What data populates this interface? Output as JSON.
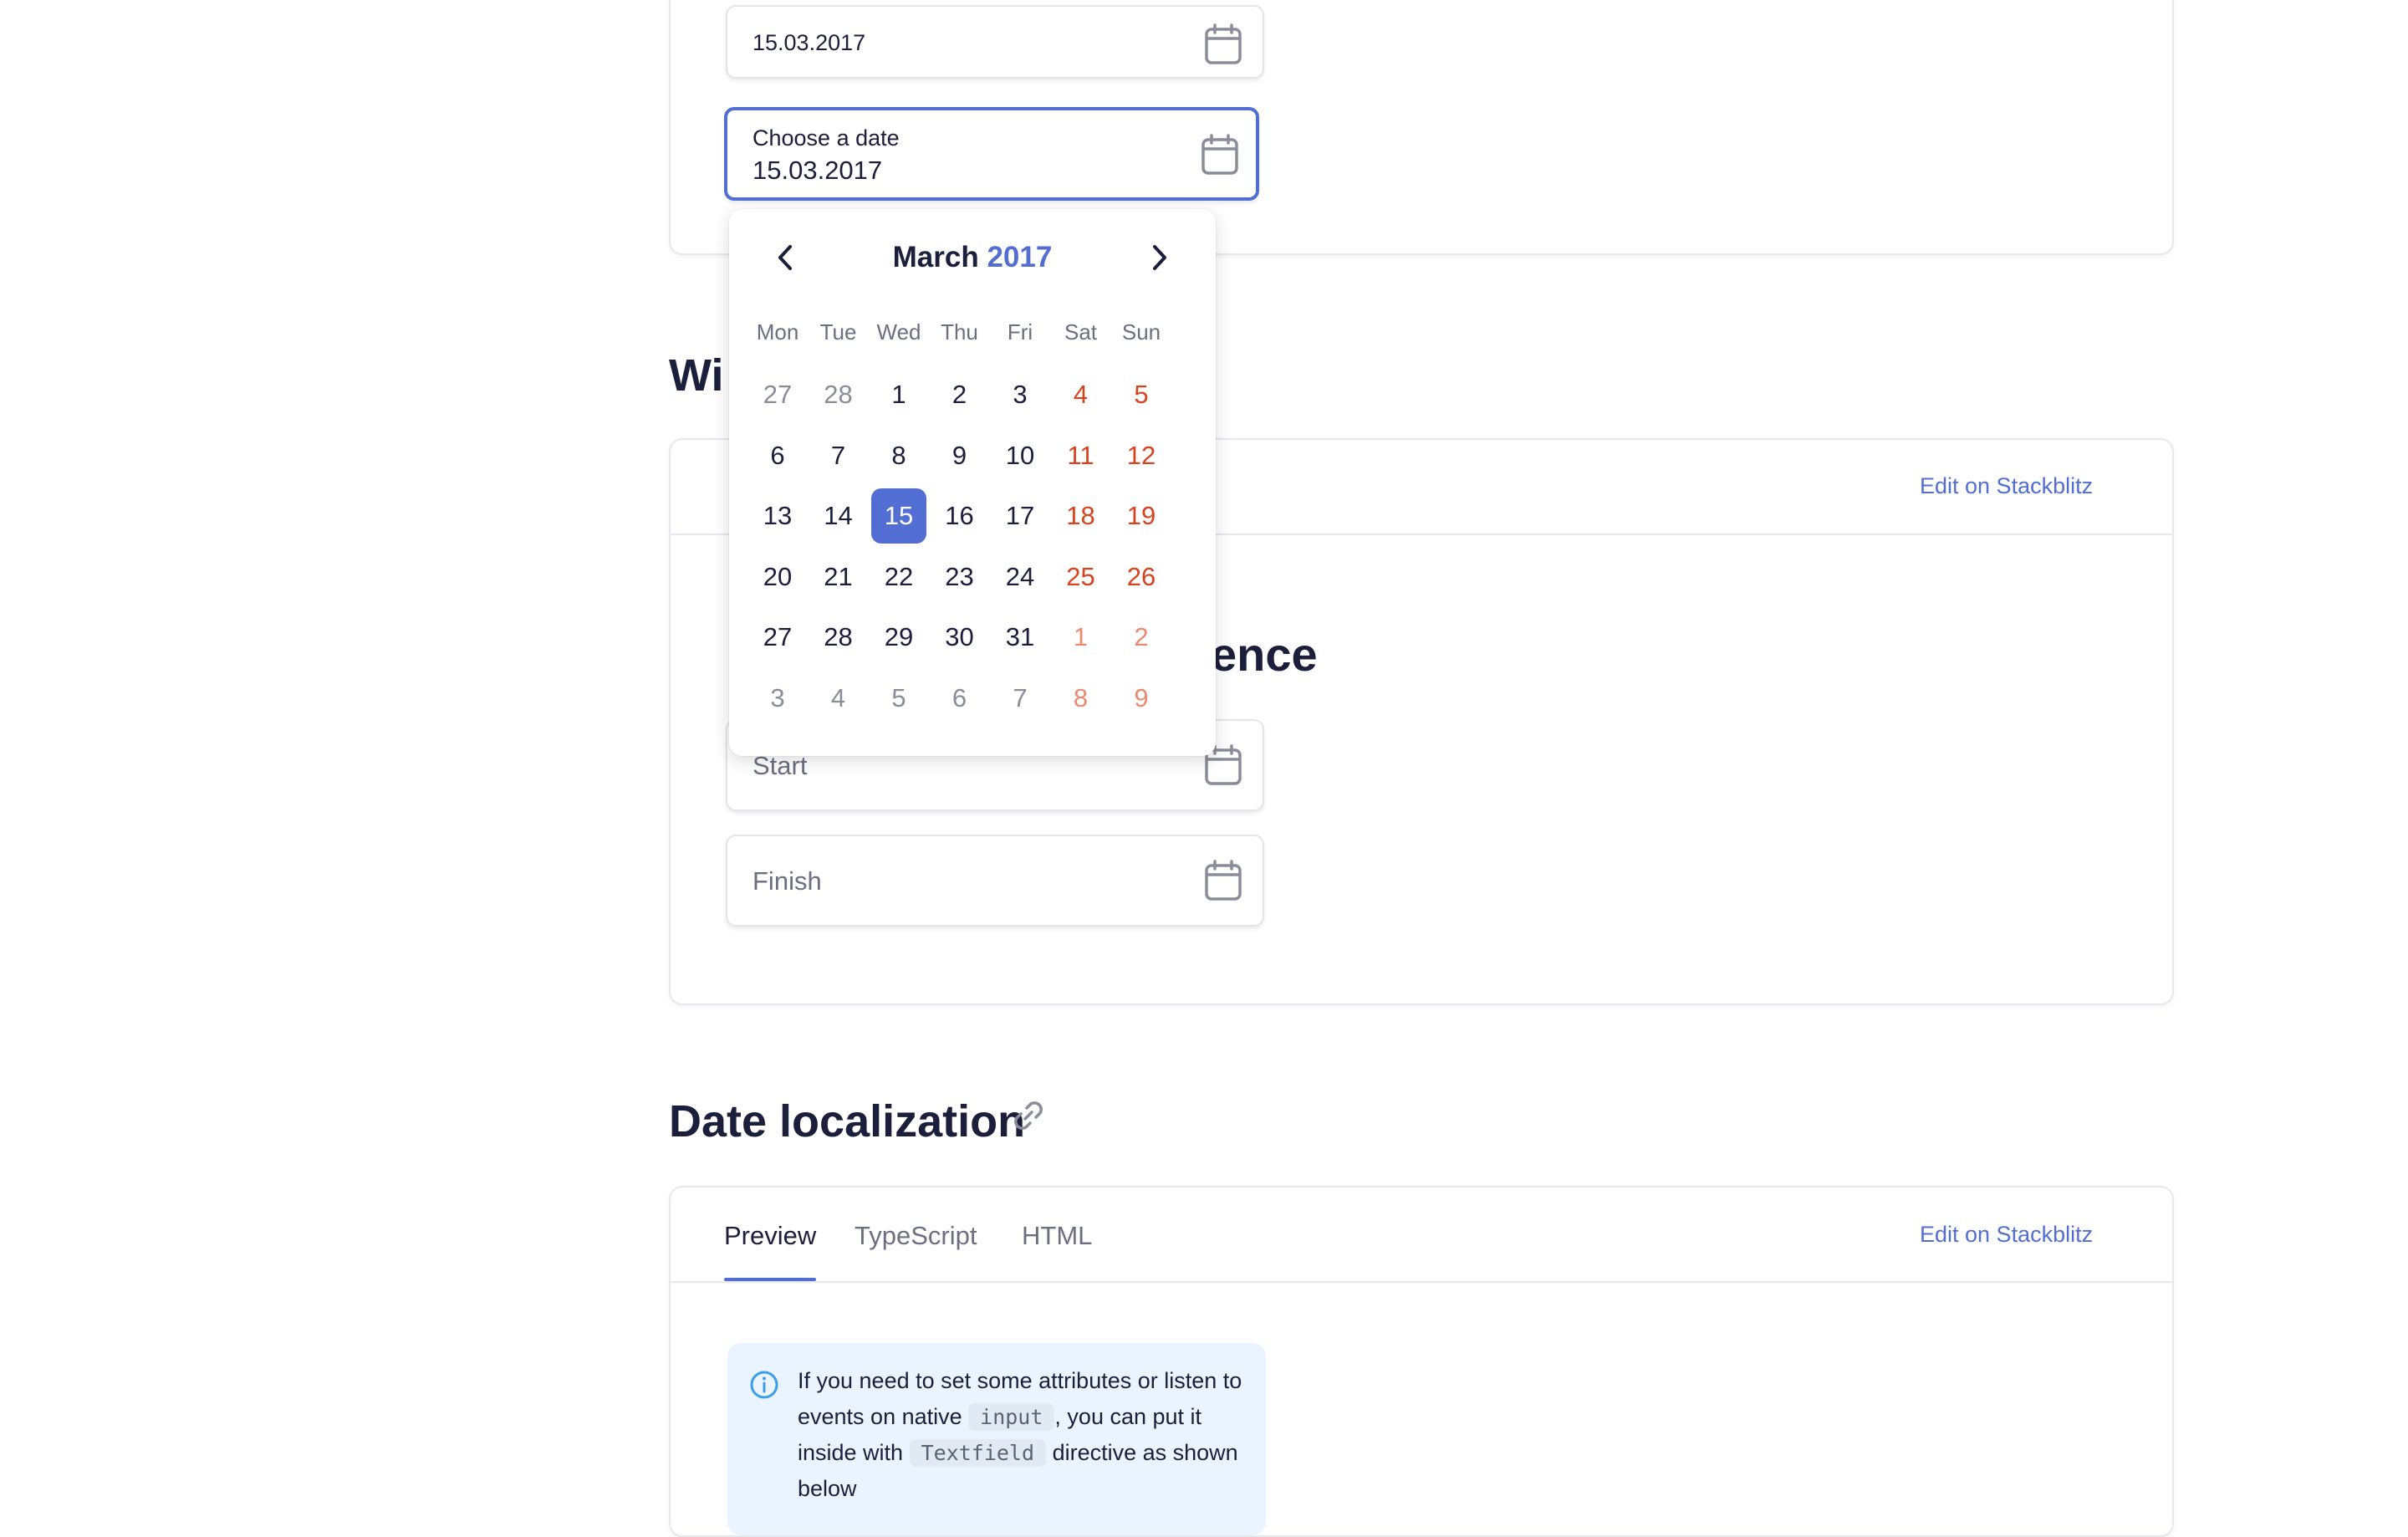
{
  "top_card": {
    "field1_value": "15.03.2017",
    "field2_label": "Choose a date",
    "field2_value": "15.03.2017"
  },
  "calendar": {
    "month": "March",
    "year": "2017",
    "weekdays": [
      "Mon",
      "Tue",
      "Wed",
      "Thu",
      "Fri",
      "Sat",
      "Sun"
    ],
    "weeks": [
      [
        [
          "27",
          "other"
        ],
        [
          "28",
          "other"
        ],
        [
          "1",
          ""
        ],
        [
          "2",
          ""
        ],
        [
          "3",
          ""
        ],
        [
          "4",
          "weekend"
        ],
        [
          "5",
          "weekend"
        ]
      ],
      [
        [
          "6",
          ""
        ],
        [
          "7",
          ""
        ],
        [
          "8",
          ""
        ],
        [
          "9",
          ""
        ],
        [
          "10",
          ""
        ],
        [
          "11",
          "weekend"
        ],
        [
          "12",
          "weekend"
        ]
      ],
      [
        [
          "13",
          ""
        ],
        [
          "14",
          ""
        ],
        [
          "15",
          "selected"
        ],
        [
          "16",
          ""
        ],
        [
          "17",
          ""
        ],
        [
          "18",
          "weekend"
        ],
        [
          "19",
          "weekend"
        ]
      ],
      [
        [
          "20",
          ""
        ],
        [
          "21",
          ""
        ],
        [
          "22",
          ""
        ],
        [
          "23",
          ""
        ],
        [
          "24",
          ""
        ],
        [
          "25",
          "weekend"
        ],
        [
          "26",
          "weekend"
        ]
      ],
      [
        [
          "27",
          ""
        ],
        [
          "28",
          ""
        ],
        [
          "29",
          ""
        ],
        [
          "30",
          ""
        ],
        [
          "31",
          ""
        ],
        [
          "1",
          "weekend other"
        ],
        [
          "2",
          "weekend other"
        ]
      ],
      [
        [
          "3",
          "other"
        ],
        [
          "4",
          "other"
        ],
        [
          "5",
          "other"
        ],
        [
          "6",
          "other"
        ],
        [
          "7",
          "other"
        ],
        [
          "8",
          "weekend other"
        ],
        [
          "9",
          "weekend other"
        ]
      ]
    ]
  },
  "section2": {
    "heading_visible_part": "Wi",
    "preview_heading_visible_part": "ence",
    "edit_link": "Edit on Stackblitz",
    "start_placeholder": "Start",
    "finish_placeholder": "Finish"
  },
  "section3": {
    "heading": "Date localization",
    "tabs": [
      "Preview",
      "TypeScript",
      "HTML"
    ],
    "active_tab": "Preview",
    "edit_link": "Edit on Stackblitz",
    "info": {
      "text_1": "If you need to set some attributes or listen to events on native",
      "code_1": "input",
      "text_2": ", you can put it inside with",
      "code_2": "Textfield",
      "text_3": "directive as shown below"
    }
  },
  "colors": {
    "accent": "#526ed3",
    "weekend": "#d9421f",
    "text": "#1b1f3b",
    "muted": "#6b6f80",
    "info_bg": "#eaf4fe"
  }
}
